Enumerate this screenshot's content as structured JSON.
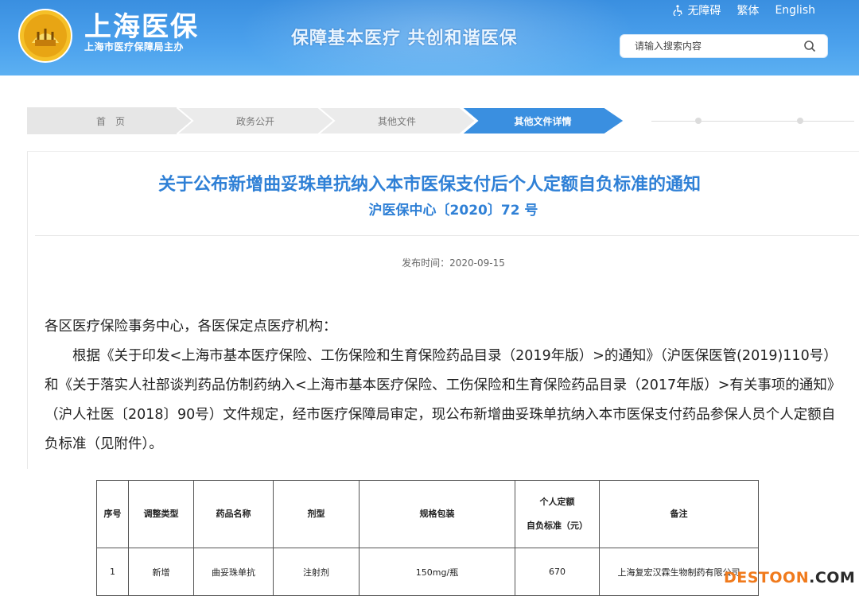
{
  "header": {
    "site_name": "上海医保",
    "site_sub": "上海市医疗保障局主办",
    "slogan": "保障基本医疗  共创和谐医保",
    "links": {
      "accessibility": "无障碍",
      "traditional": "繁体",
      "english": "English"
    },
    "search": {
      "placeholder": "请输入搜索内容"
    },
    "colors": {
      "header_bg": "#4aa0ec",
      "title_blue": "#2f80d6",
      "crumb_active": "#3a8fe0"
    }
  },
  "breadcrumb": {
    "items": [
      "首　页",
      "政务公开",
      "其他文件",
      "其他文件详情"
    ]
  },
  "article": {
    "title": "关于公布新增曲妥珠单抗纳入本市医保支付后个人定额自负标准的通知",
    "doc_number": "沪医保中心〔2020〕72 号",
    "publish_date": "发布时间：2020-09-15",
    "salutation": "各区医疗保险事务中心，各医保定点医疗机构：",
    "paragraph": "根据《关于印发<上海市基本医疗保险、工伤保险和生育保险药品目录（2019年版）>的通知》（沪医保医管(2019)110号）和《关于落实人社部谈判药品仿制药纳入<上海市基本医疗保险、工伤保险和生育保险药品目录（2017年版）>有关事项的通知》（沪人社医〔2018〕90号）文件规定，经市医疗保障局审定，现公布新增曲妥珠单抗纳入本市医保支付药品参保人员个人定额自负标准（见附件）。"
  },
  "table": {
    "headers": {
      "no": "序号",
      "type": "调整类型",
      "drug": "药品名称",
      "form": "剂型",
      "spec": "规格包装",
      "fee_line1": "个人定额",
      "fee_line2": "自负标准（元）",
      "remark": "备注"
    },
    "rows": [
      {
        "no": "1",
        "type": "新增",
        "drug": "曲妥珠单抗",
        "form": "注射剂",
        "spec": "150mg/瓶",
        "fee": "670",
        "remark": "上海复宏汉霖生物制药有限公司"
      }
    ]
  },
  "watermark": {
    "part1": "DESTOON",
    "part2": ".COM"
  }
}
